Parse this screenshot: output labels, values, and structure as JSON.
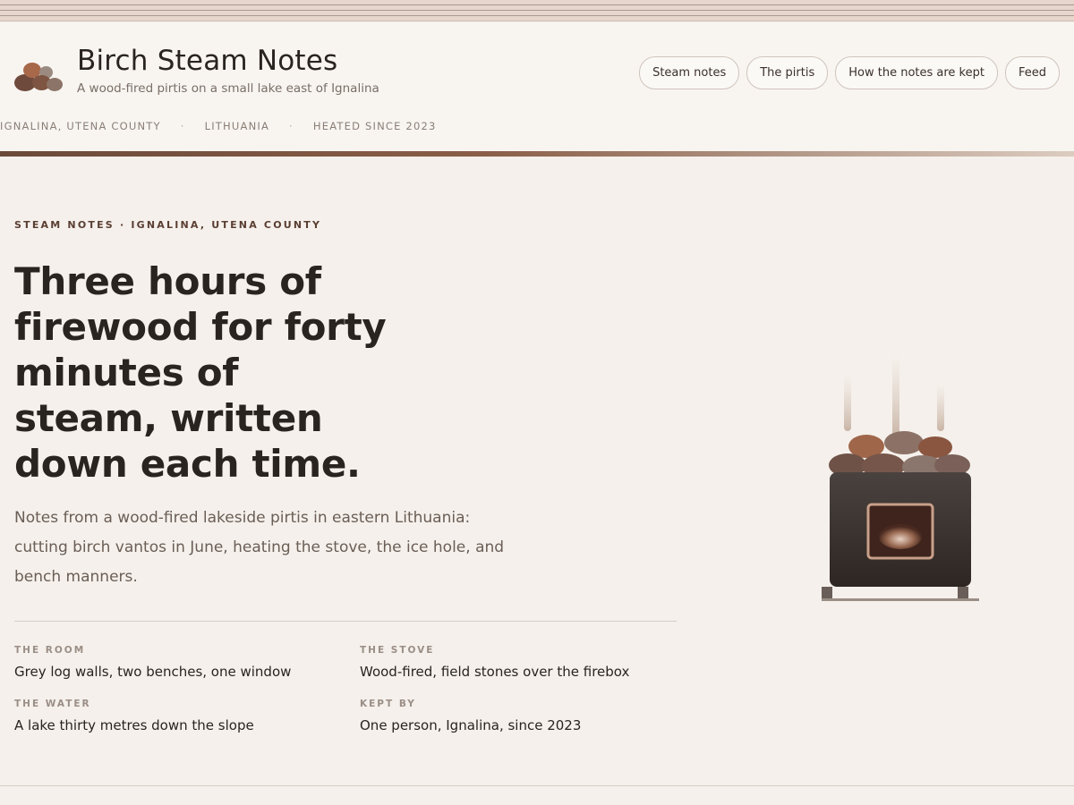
{
  "site": {
    "title": "Birch Steam Notes",
    "tagline": "A wood-fired pirtis on a small lake east of Ignalina"
  },
  "nav": [
    {
      "label": "Steam notes"
    },
    {
      "label": "The pirtis"
    },
    {
      "label": "How the notes are kept"
    },
    {
      "label": "Feed"
    }
  ],
  "location": {
    "place": "IGNALINA, UTENA COUNTY",
    "country": "LITHUANIA",
    "since": "HEATED SINCE 2023",
    "separator": "·"
  },
  "hero": {
    "eyebrow": "STEAM NOTES · IGNALINA, UTENA COUNTY",
    "headline": "Three hours of firewood for forty minutes of steam, written down each time.",
    "lede": "Notes from a wood-fired lakeside pirtis in eastern Lithuania: cutting birch vantos in June, heating the stove, the ice hole, and bench manners."
  },
  "facts": [
    {
      "label": "THE ROOM",
      "value": "Grey log walls, two benches, one window"
    },
    {
      "label": "THE STOVE",
      "value": "Wood-fired, field stones over the firebox"
    },
    {
      "label": "THE WATER",
      "value": "A lake thirty metres down the slope"
    },
    {
      "label": "KEPT BY",
      "value": "One person, Ignalina, since 2023"
    }
  ],
  "colors": {
    "background": "#f5f0eb",
    "accent": "#6b4a3a",
    "text": "#2a2420",
    "muted": "#6a5e56"
  },
  "icons": {
    "logo": "sauna-stones-icon",
    "illustration": "sauna-stove-illustration"
  }
}
